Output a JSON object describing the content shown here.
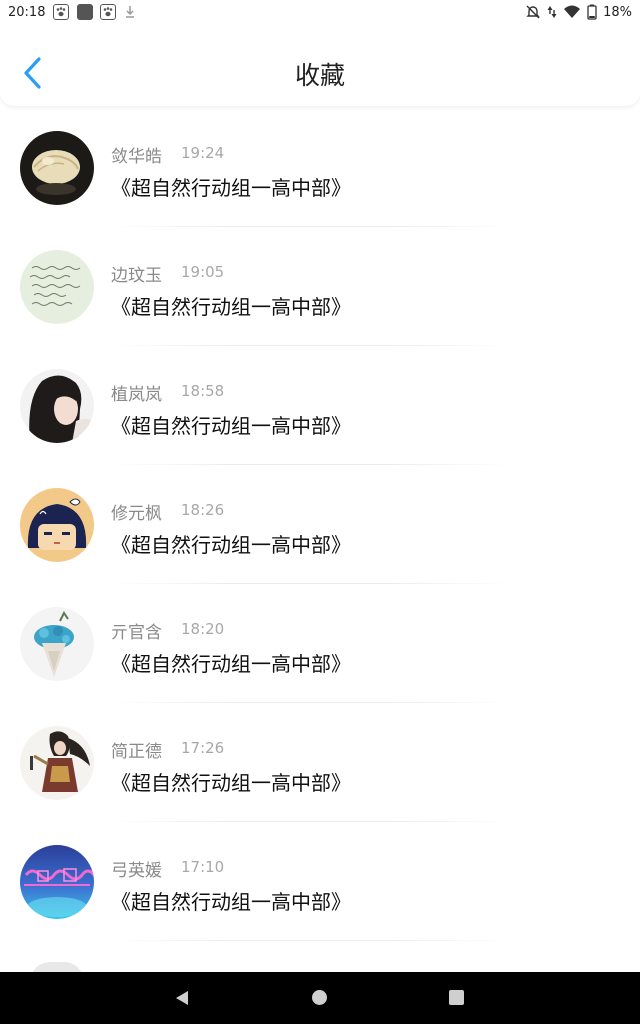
{
  "status_bar": {
    "time": "20:18",
    "battery_percent": "18%",
    "icons": [
      "baidu-paw-icon",
      "app-square-icon",
      "baidu-paw-icon",
      "download-icon",
      "alarm-off-icon",
      "data-arrows-icon",
      "wifi-icon",
      "battery-icon"
    ]
  },
  "header": {
    "title": "收藏",
    "back_icon": "chevron-left-icon"
  },
  "favorites": [
    {
      "name": "敛华皓",
      "time": "19:24",
      "title": "《超自然行动组一高中部》",
      "avatar": "seashell"
    },
    {
      "name": "边玟玉",
      "time": "19:05",
      "title": "《超自然行动组一高中部》",
      "avatar": "handwriting"
    },
    {
      "name": "植岚岚",
      "time": "18:58",
      "title": "《超自然行动组一高中部》",
      "avatar": "girl-photo"
    },
    {
      "name": "修元枫",
      "time": "18:26",
      "title": "《超自然行动组一高中部》",
      "avatar": "cartoon-girl"
    },
    {
      "name": "亓官含",
      "time": "18:20",
      "title": "《超自然行动组一高中部》",
      "avatar": "blue-bouquet"
    },
    {
      "name": "简正德",
      "time": "17:26",
      "title": "《超自然行动组一高中部》",
      "avatar": "anime-warrior"
    },
    {
      "name": "弓英媛",
      "time": "17:10",
      "title": "《超自然行动组一高中部》",
      "avatar": "neon-sign"
    }
  ],
  "colors": {
    "accent": "#2a9df4",
    "name_text": "#8a8a8a",
    "time_text": "#a8a8a8",
    "title_text": "#111111"
  },
  "nav_bar": {
    "icons": [
      "back-triangle-icon",
      "home-circle-icon",
      "recents-square-icon"
    ]
  }
}
